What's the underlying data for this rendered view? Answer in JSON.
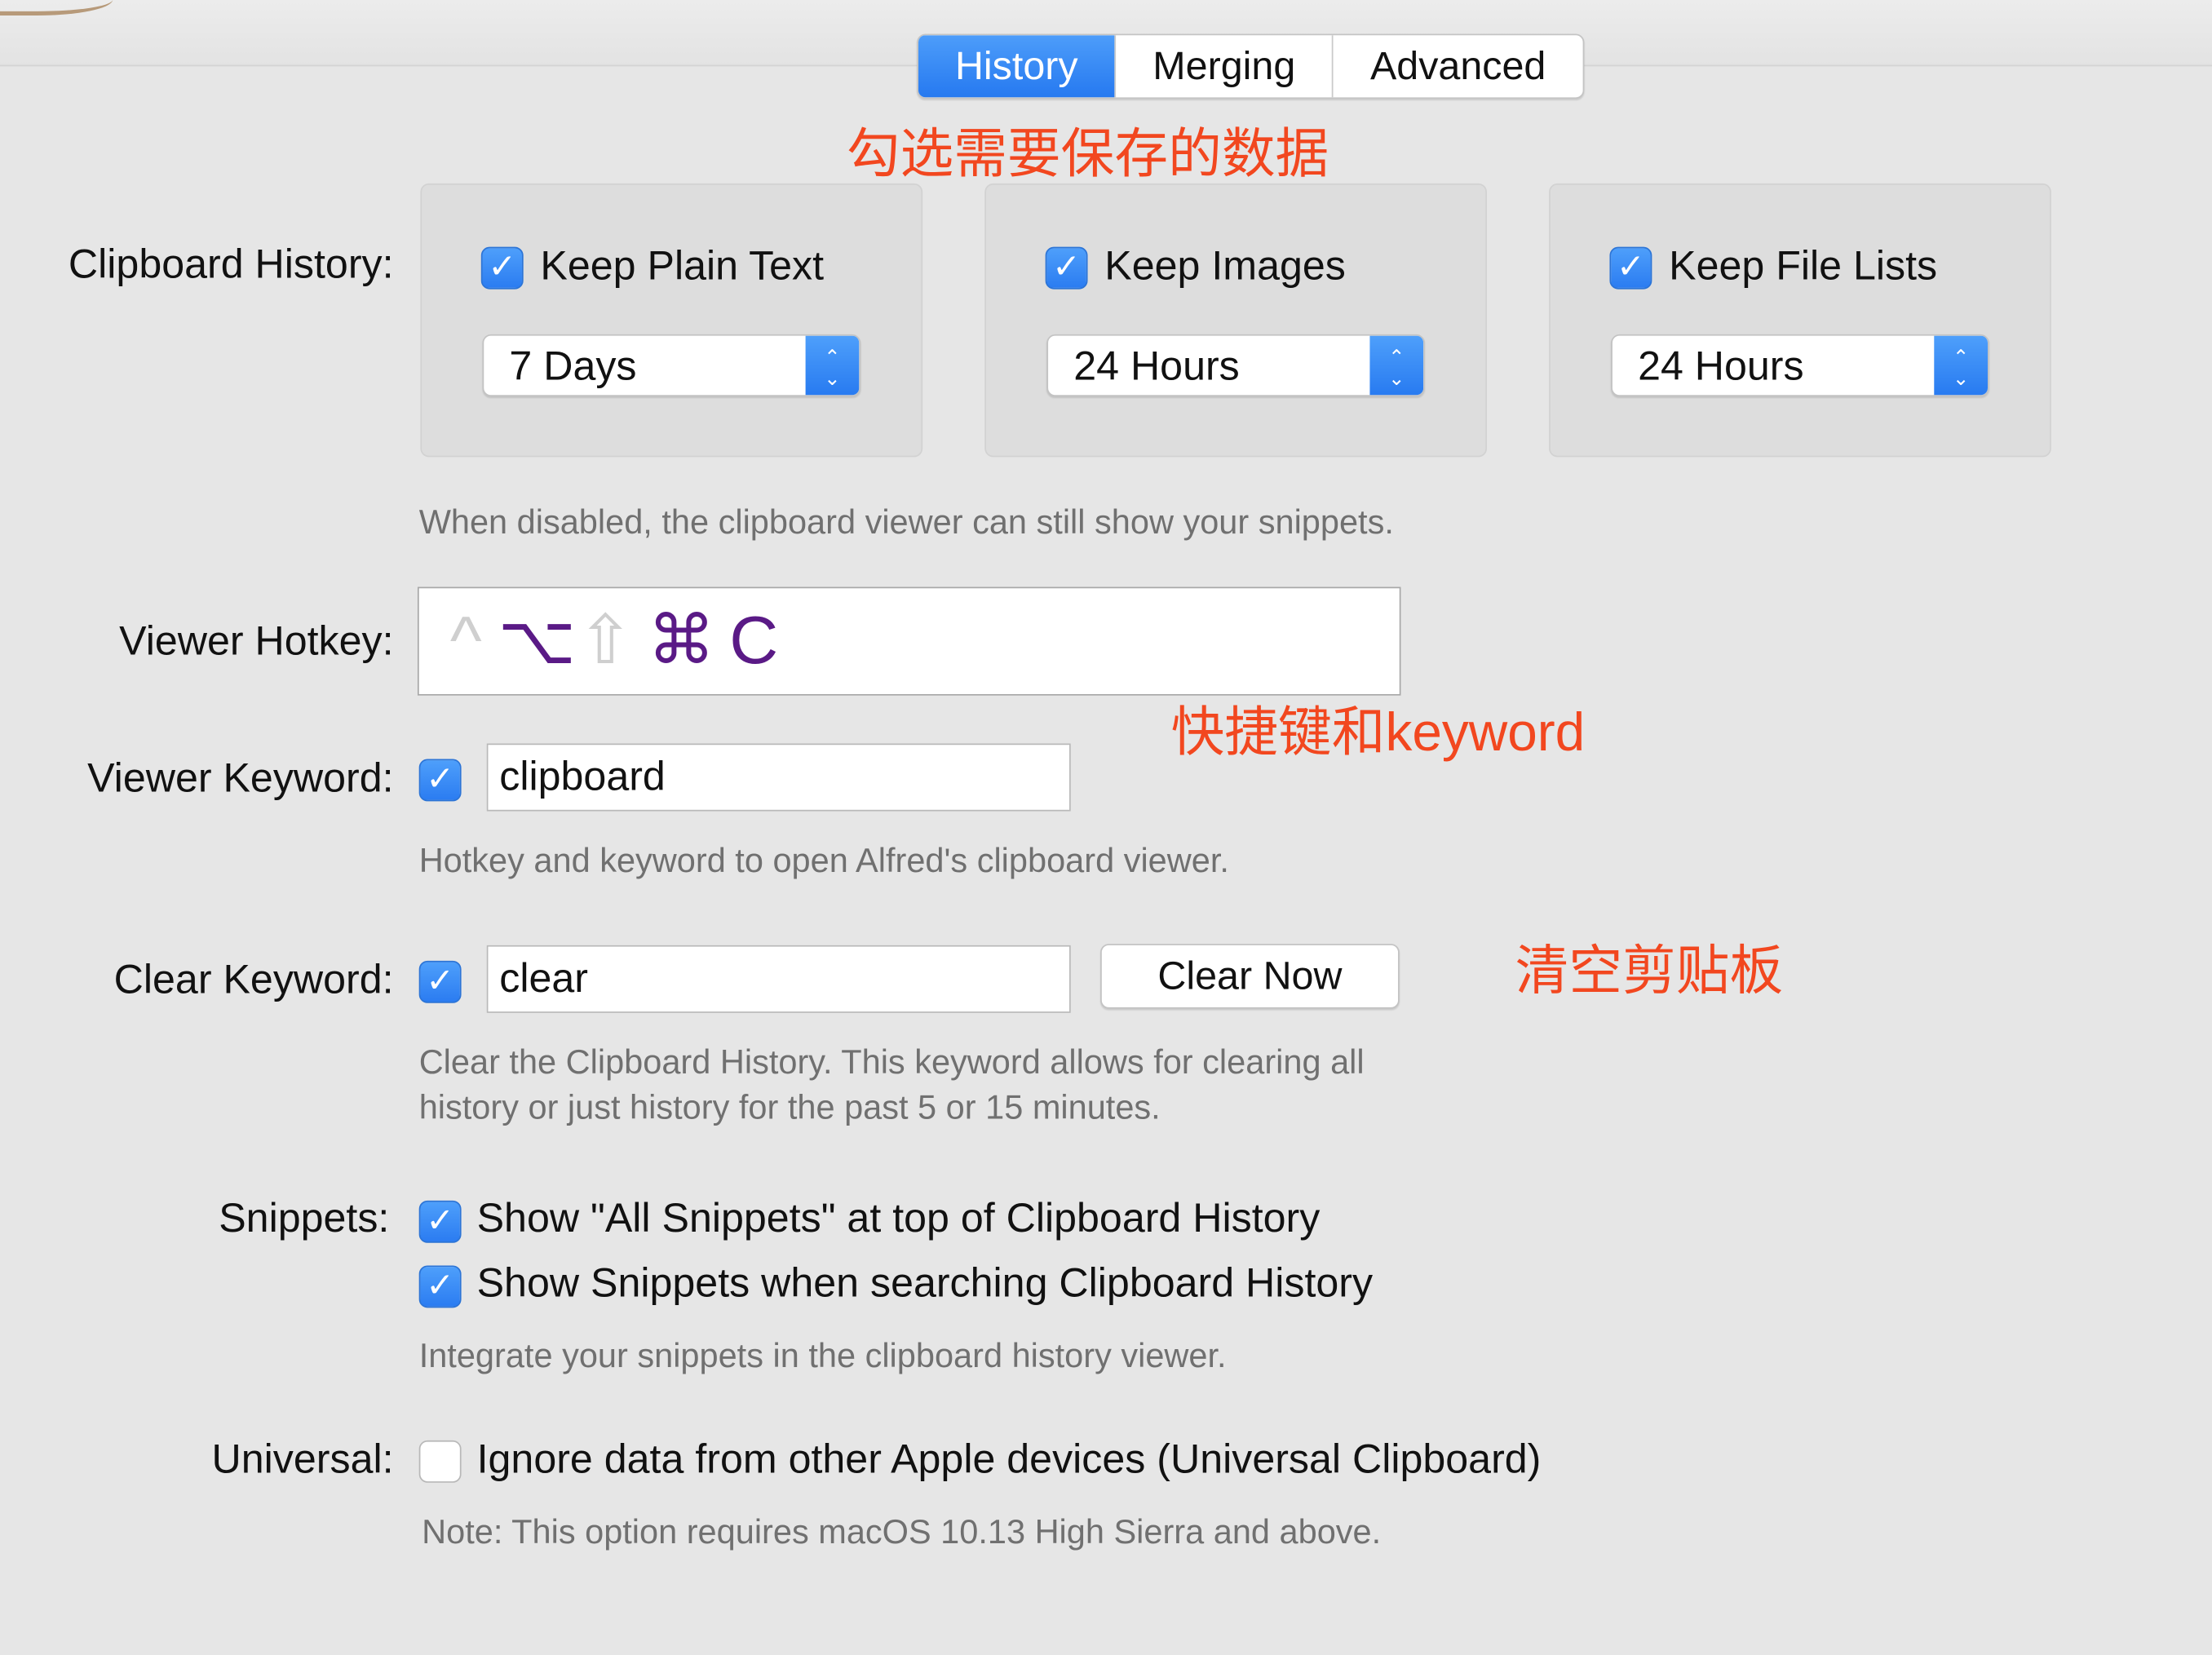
{
  "tabs": [
    {
      "label": "History",
      "active": true
    },
    {
      "label": "Merging",
      "active": false
    },
    {
      "label": "Advanced",
      "active": false
    }
  ],
  "annotations": {
    "select_data": "勾选需要保存的数据",
    "hotkey_keyword": "快捷键和keyword",
    "clear_clipboard": "清空剪贴板"
  },
  "clipboard_history": {
    "label": "Clipboard History:",
    "groups": [
      {
        "checkbox_label": "Keep Plain Text",
        "checked": true,
        "duration": "7 Days"
      },
      {
        "checkbox_label": "Keep Images",
        "checked": true,
        "duration": "24 Hours"
      },
      {
        "checkbox_label": "Keep File Lists",
        "checked": true,
        "duration": "24 Hours"
      }
    ],
    "help": "When disabled, the clipboard viewer can still show your snippets."
  },
  "viewer_hotkey": {
    "label": "Viewer Hotkey:",
    "keys": [
      "^",
      "⌥",
      "⇧",
      "⌘",
      "C"
    ],
    "active_keys": [
      "⌥",
      "⌘",
      "C"
    ]
  },
  "viewer_keyword": {
    "label": "Viewer Keyword:",
    "checked": true,
    "value": "clipboard",
    "help": "Hotkey and keyword to open Alfred's clipboard viewer."
  },
  "clear_keyword": {
    "label": "Clear Keyword:",
    "checked": true,
    "value": "clear",
    "button": "Clear Now",
    "help_line1": "Clear the Clipboard History. This keyword allows for clearing all",
    "help_line2": "history or just history for the past 5 or 15 minutes."
  },
  "snippets": {
    "label": "Snippets:",
    "options": [
      {
        "text": "Show \"All Snippets\" at top of Clipboard History",
        "checked": true
      },
      {
        "text": "Show Snippets when searching Clipboard History",
        "checked": true
      }
    ],
    "help": "Integrate your snippets in the clipboard history viewer."
  },
  "universal": {
    "label": "Universal:",
    "checked": false,
    "text": "Ignore data from other Apple devices (Universal Clipboard)",
    "help": "Note: This option requires macOS 10.13 High Sierra and above."
  },
  "icons": {
    "checkmark": "✓",
    "stepper_up": "⌃",
    "stepper_down": "⌄"
  },
  "colors": {
    "accent": "#2b7cf1",
    "annotation": "#f2471f",
    "hotkey_active": "#5a1a86",
    "hotkey_inactive": "#cfcfcf",
    "background": "#e6e6e6"
  }
}
